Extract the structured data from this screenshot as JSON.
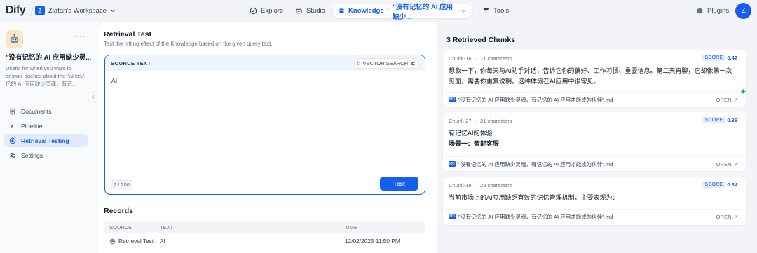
{
  "brand": {
    "logo": "Dify"
  },
  "workspace": {
    "badge": "Z",
    "name": "Zlatan's Workspace"
  },
  "nav": {
    "explore": "Explore",
    "studio": "Studio",
    "knowledge": "Knowledge",
    "knowledge_sep": "/",
    "dataset": "\"没有记忆的 AI 应用缺少...",
    "tools": "Tools"
  },
  "header_right": {
    "plugins": "Plugins",
    "avatar": "Z"
  },
  "sidebar": {
    "dataset_name": "\"没有记忆的 AI 应用缺少灵...",
    "dataset_desc": "Useful for when you want to answer queries about the \"没有记忆的 AI 应用缺少灵魂，有记...",
    "items": [
      {
        "label": "Documents",
        "icon": "document-icon"
      },
      {
        "label": "Pipeline",
        "icon": "pipeline-icon"
      },
      {
        "label": "Retrieval Testing",
        "icon": "target-icon",
        "active": true
      },
      {
        "label": "Settings",
        "icon": "settings-icon"
      }
    ]
  },
  "main": {
    "title": "Retrieval Test",
    "subtitle": "Test the hitting effect of the Knowledge based on the given query text.",
    "source_label": "SOURCE TEXT",
    "search_mode": "VECTOR SEARCH",
    "query": "AI",
    "char_count": "2 / 200",
    "test_button": "Test",
    "records_title": "Records",
    "records_columns": [
      "SOURCE",
      "TEXT",
      "TIME"
    ],
    "records": [
      {
        "source": "Retrieval Test",
        "text": "AI",
        "time": "12/02/2025 11:50 PM"
      }
    ]
  },
  "results": {
    "title": "3 Retrieved Chunks",
    "score_label": "SCORE",
    "open_label": "OPEN",
    "chunks": [
      {
        "id": "Chunk-16",
        "chars": "71 characters",
        "score": "0.42",
        "line1": "想象一下，你每天与AI助手对话，告诉它你的偏好、工作习惯、重要信息。第二天再聊，它却像第一次",
        "line2": "见面，需要你重复说明。这种体验在AI应用中很常见。",
        "file": "\"没有记忆的 AI 应用缺少灵魂，有记忆的 AI 应用才能成为伙伴\".md"
      },
      {
        "id": "Chunk-27",
        "chars": "21 characters",
        "score": "0.36",
        "line1": "有记忆AI的体验",
        "line2": "场景一：智能客服",
        "file": "\"没有记忆的 AI 应用缺少灵魂，有记忆的 AI 应用才能成为伙伴\".md"
      },
      {
        "id": "Chunk-18",
        "chars": "28 characters",
        "score": "0.34",
        "line1": "当前市场上的AI应用缺乏有效的记忆管理机制，主要表现为：",
        "line2": "",
        "file": "\"没有记忆的 AI 应用缺少灵魂，有记忆的 AI 应用才能成为伙伴\".md"
      }
    ]
  },
  "colors": {
    "accent": "#155eef",
    "active_bg": "#e1eaff",
    "panel_bg": "#f2f4f7"
  }
}
